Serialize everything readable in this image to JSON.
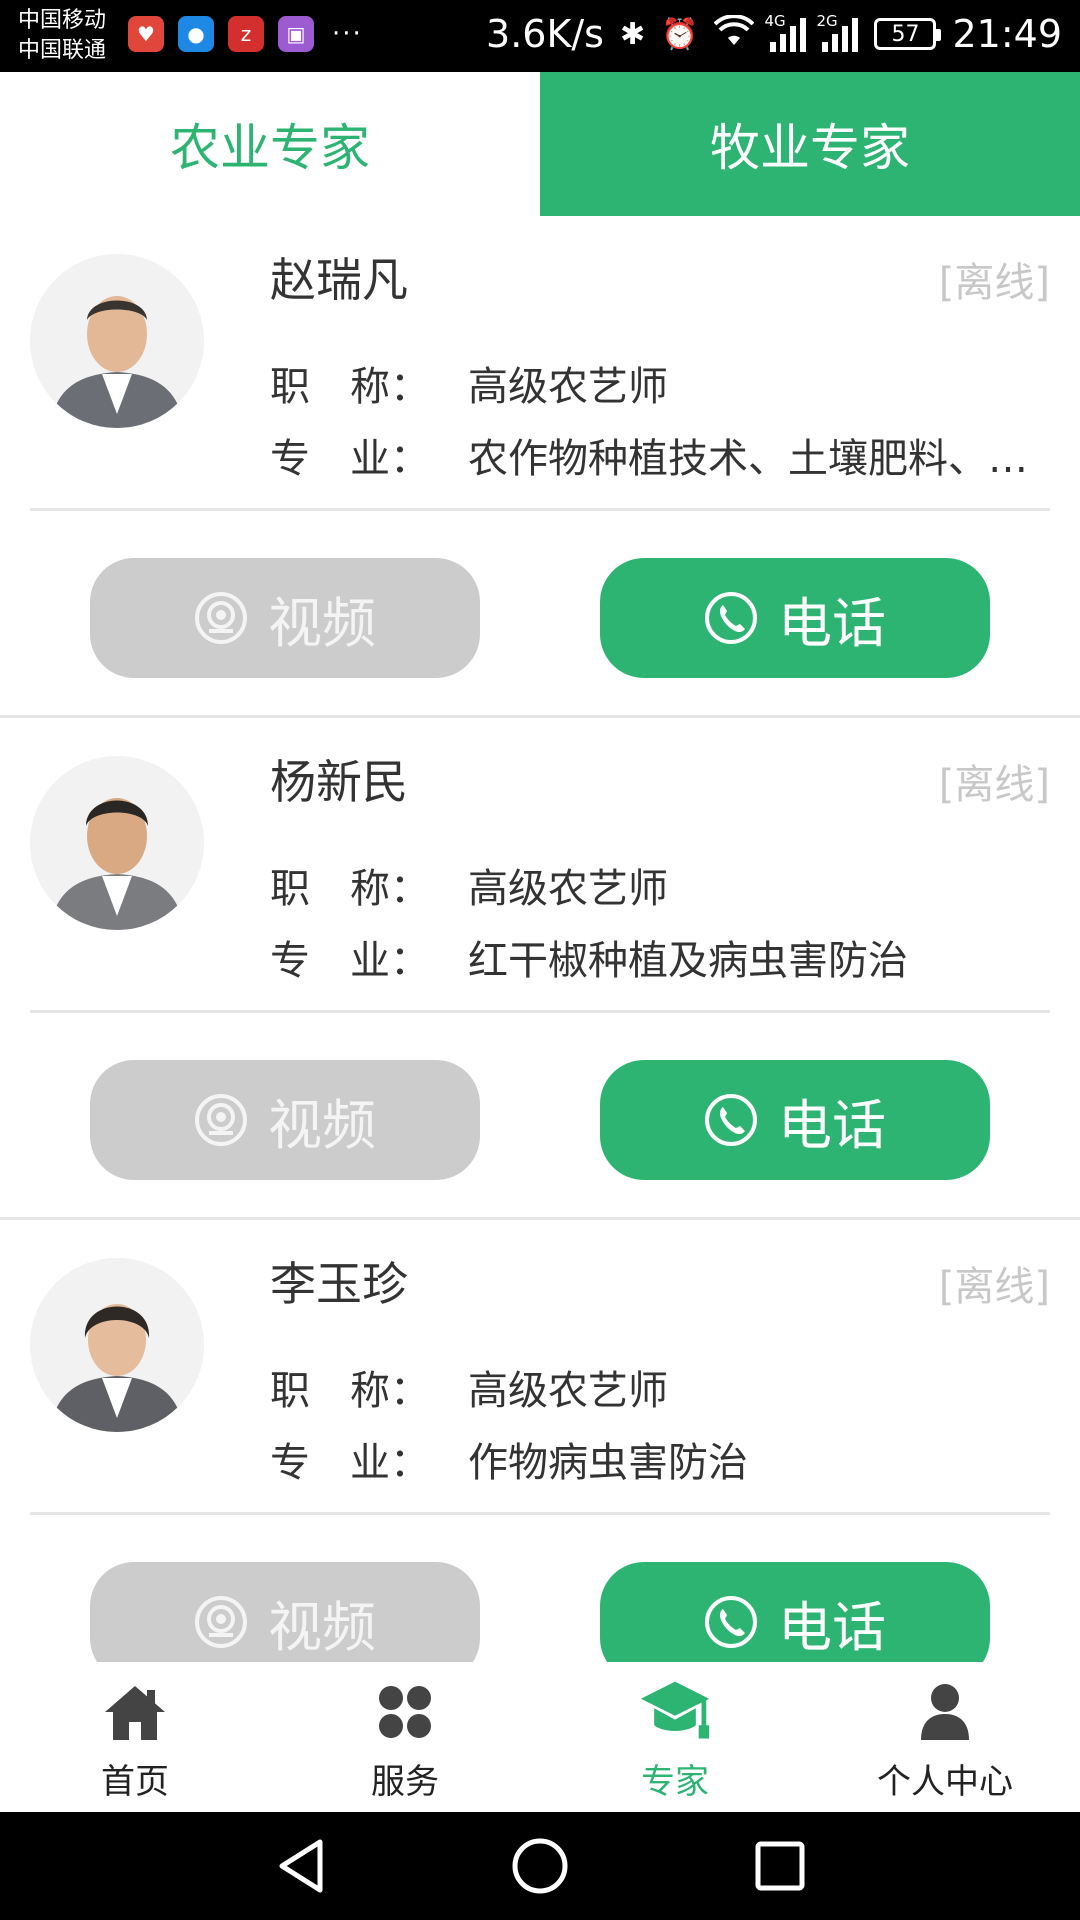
{
  "status_bar": {
    "carrier_1": "中国移动",
    "carrier_2": "中国联通",
    "more": "···",
    "net_speed": "3.6K/s",
    "sim1_net": "4G",
    "sim2_net": "2G",
    "battery": "57",
    "time": "21:49",
    "icons": [
      "health-app-icon",
      "message-app-icon",
      "zhihu-app-icon",
      "gallery-app-icon",
      "bluetooth-icon",
      "alarm-icon",
      "wifi-icon",
      "signal-icon",
      "battery-icon"
    ]
  },
  "tabs": [
    {
      "label": "农业专家",
      "active": true
    },
    {
      "label": "牧业专家",
      "active": false
    }
  ],
  "labels": {
    "title": "职　称：",
    "major": "专　业：",
    "video": "视频",
    "call": "电话"
  },
  "experts": [
    {
      "name": "赵瑞凡",
      "status": "[离线]",
      "title": "高级农艺师",
      "major": "农作物种植技术、土壤肥料、…"
    },
    {
      "name": "杨新民",
      "status": "[离线]",
      "title": "高级农艺师",
      "major": "红干椒种植及病虫害防治"
    },
    {
      "name": "李玉珍",
      "status": "[离线]",
      "title": "高级农艺师",
      "major": "作物病虫害防治"
    }
  ],
  "bottom_nav": [
    {
      "label": "首页",
      "icon": "home-icon",
      "active": false
    },
    {
      "label": "服务",
      "icon": "service-grid-icon",
      "active": false
    },
    {
      "label": "专家",
      "icon": "graduation-cap-icon",
      "active": true
    },
    {
      "label": "个人中心",
      "icon": "user-icon",
      "active": false
    }
  ],
  "colors": {
    "accent": "#2db472",
    "disabled_button": "#cccccc",
    "offline_text": "#c8c8c8"
  }
}
